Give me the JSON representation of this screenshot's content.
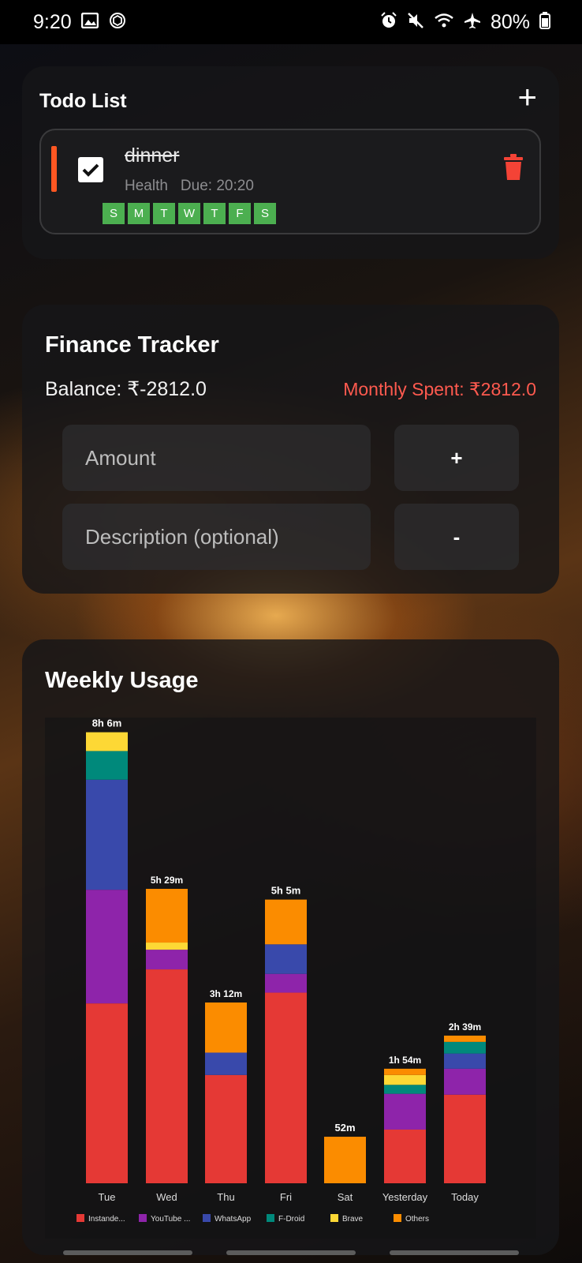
{
  "status_bar": {
    "time": "9:20",
    "left_icons": [
      "image-icon",
      "chatgpt-icon"
    ],
    "right_icons": [
      "alarm-icon",
      "mute-icon",
      "wifi-icon",
      "airplane-icon"
    ],
    "battery": "80%"
  },
  "todo": {
    "title": "Todo List",
    "add_label": "+",
    "item": {
      "name": "dinner",
      "category": "Health",
      "due": "Due: 20:20",
      "completed": true,
      "days": [
        "S",
        "M",
        "T",
        "W",
        "T",
        "F",
        "S"
      ]
    }
  },
  "finance": {
    "title": "Finance Tracker",
    "balance": "Balance: ₹-2812.0",
    "monthly_spent": "Monthly Spent: ₹2812.0",
    "amount_placeholder": "Amount",
    "description_placeholder": "Description (optional)",
    "add_label": "+",
    "subtract_label": "-"
  },
  "usage": {
    "title": "Weekly Usage"
  },
  "colors": {
    "accent_red": "#e53935",
    "check_green": "#4caf50",
    "priority_orange": "#ff5722"
  },
  "chart_data": {
    "type": "bar",
    "stacked": true,
    "unit": "minutes",
    "categories": [
      "Tue",
      "Wed",
      "Thu",
      "Fri",
      "Sat",
      "Yesterday",
      "Today"
    ],
    "totals_labels": [
      "8h 6m",
      "5h 29m",
      "3h 12m",
      "5h 5m",
      "52m",
      "1h 54m",
      "2h 39m"
    ],
    "series": [
      {
        "name": "Instande...",
        "color": "#e53935",
        "values": [
          201,
          239,
          121,
          213,
          0,
          60,
          99
        ]
      },
      {
        "name": "YouTube ...",
        "color": "#8e24aa",
        "values": [
          127,
          22,
          0,
          21,
          0,
          40,
          29
        ]
      },
      {
        "name": "WhatsApp",
        "color": "#3949ab",
        "values": [
          123,
          0,
          25,
          33,
          0,
          0,
          17
        ]
      },
      {
        "name": "F-Droid",
        "color": "#00897b",
        "values": [
          32,
          0,
          0,
          0,
          0,
          10,
          13
        ]
      },
      {
        "name": "Brave",
        "color": "#fdd835",
        "values": [
          21,
          8,
          0,
          0,
          0,
          11,
          0
        ]
      },
      {
        "name": "Others",
        "color": "#fb8c00",
        "values": [
          0,
          60,
          56,
          50,
          52,
          7,
          7
        ]
      }
    ]
  }
}
